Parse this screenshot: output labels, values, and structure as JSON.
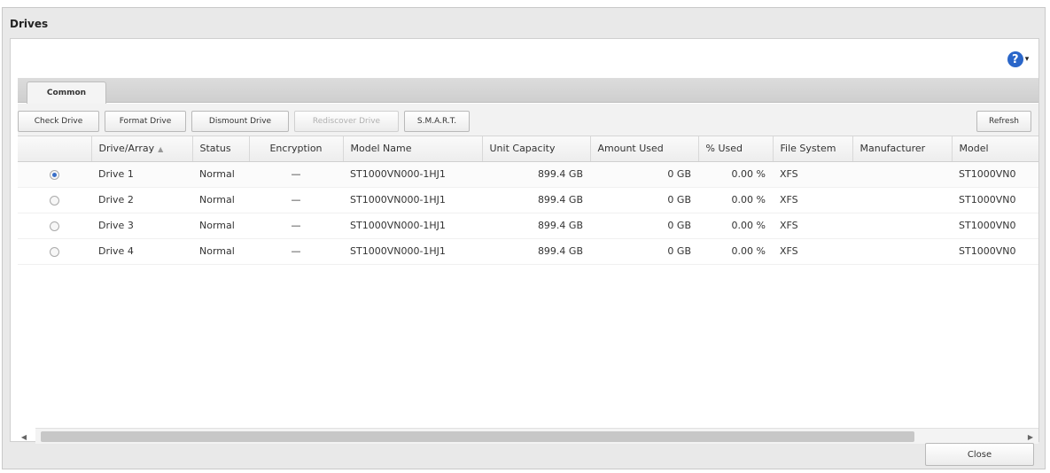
{
  "window": {
    "title": "Drives"
  },
  "help": {
    "icon": "help-icon",
    "glyph": "?",
    "caret": "▾"
  },
  "tabs": [
    {
      "label": "Common"
    }
  ],
  "toolbar": {
    "check_drive": "Check Drive",
    "format_drive": "Format Drive",
    "dismount_drive": "Dismount Drive",
    "rediscover_drive": "Rediscover Drive",
    "smart": "S.M.A.R.T.",
    "refresh": "Refresh"
  },
  "table": {
    "columns": {
      "drive_array": "Drive/Array",
      "status": "Status",
      "encryption": "Encryption",
      "model_name": "Model Name",
      "unit_capacity": "Unit Capacity",
      "amount_used": "Amount Used",
      "percent_used": "% Used",
      "file_system": "File System",
      "manufacturer": "Manufacturer",
      "model": "Model"
    },
    "rows": [
      {
        "selected": true,
        "drive": "Drive 1",
        "status": "Normal",
        "encryption": "—",
        "model_name": "ST1000VN000-1HJ1",
        "unit_capacity": "899.4 GB",
        "amount_used": "0 GB",
        "percent_used": "0.00 %",
        "file_system": "XFS",
        "manufacturer": "",
        "model": "ST1000VN0"
      },
      {
        "selected": false,
        "drive": "Drive 2",
        "status": "Normal",
        "encryption": "—",
        "model_name": "ST1000VN000-1HJ1",
        "unit_capacity": "899.4 GB",
        "amount_used": "0 GB",
        "percent_used": "0.00 %",
        "file_system": "XFS",
        "manufacturer": "",
        "model": "ST1000VN0"
      },
      {
        "selected": false,
        "drive": "Drive 3",
        "status": "Normal",
        "encryption": "—",
        "model_name": "ST1000VN000-1HJ1",
        "unit_capacity": "899.4 GB",
        "amount_used": "0 GB",
        "percent_used": "0.00 %",
        "file_system": "XFS",
        "manufacturer": "",
        "model": "ST1000VN0"
      },
      {
        "selected": false,
        "drive": "Drive 4",
        "status": "Normal",
        "encryption": "—",
        "model_name": "ST1000VN000-1HJ1",
        "unit_capacity": "899.4 GB",
        "amount_used": "0 GB",
        "percent_used": "0.00 %",
        "file_system": "XFS",
        "manufacturer": "",
        "model": "ST1000VN0"
      }
    ]
  },
  "scrollbar": {
    "left_arrow": "◀",
    "right_arrow": "▶"
  },
  "footer": {
    "close": "Close"
  },
  "colors": {
    "accent": "#2a66c9",
    "window_bg": "#e9e9e9"
  }
}
